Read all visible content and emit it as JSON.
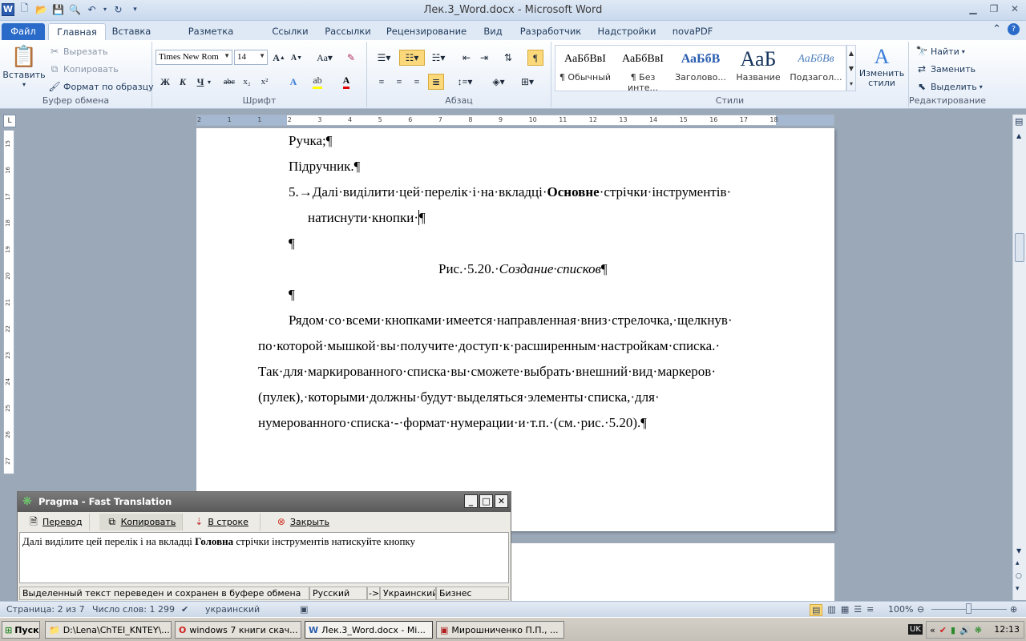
{
  "window": {
    "title": "Лек.3_Word.docx - Microsoft Word"
  },
  "tabs": [
    "Файл",
    "Главная",
    "Вставка",
    "Разметка страницы",
    "Ссылки",
    "Рассылки",
    "Рецензирование",
    "Вид",
    "Разработчик",
    "Надстройки",
    "novaPDF"
  ],
  "clipboard": {
    "paste": "Вставить",
    "cut": "Вырезать",
    "copy": "Копировать",
    "format_painter": "Формат по образцу",
    "label": "Буфер обмена"
  },
  "font": {
    "name": "Times New Rom",
    "size": "14",
    "label": "Шрифт",
    "bold": "Ж",
    "italic": "К",
    "underline": "Ч"
  },
  "paragraph": {
    "label": "Абзац"
  },
  "styles": {
    "label": "Стили",
    "items": [
      {
        "sample": "АаБбВвІ",
        "name": "¶ Обычный"
      },
      {
        "sample": "АаБбВвІ",
        "name": "¶ Без инте..."
      },
      {
        "sample": "АаБбВ",
        "name": "Заголово..."
      },
      {
        "sample": "АаБ",
        "name": "Название"
      },
      {
        "sample": "АаБбВв",
        "name": "Подзагол..."
      }
    ],
    "change": "Изменить стили"
  },
  "editing": {
    "find": "Найти",
    "replace": "Заменить",
    "select": "Выделить",
    "label": "Редактирование"
  },
  "ruler": {
    "ticks": [
      "2",
      "1",
      "1",
      "2",
      "3",
      "4",
      "5",
      "6",
      "7",
      "8",
      "9",
      "10",
      "11",
      "12",
      "13",
      "14",
      "15",
      "16",
      "17",
      "18"
    ]
  },
  "vruler": {
    "ticks": [
      "15",
      "16",
      "17",
      "18",
      "19",
      "20",
      "21",
      "22",
      "23",
      "24",
      "25",
      "26",
      "27"
    ]
  },
  "document": {
    "line1": "Ручка;¶",
    "line2": "Підручник.¶",
    "item5_pre": "5.→Далі·виділити·цей·перелік·і·на·вкладці·",
    "item5_bold": "Основне",
    "item5_post": "·стрічки·інструментів·",
    "item5_cont": "натиснути·кнопки·",
    "pilcrow": "¶",
    "caption_pre": "Рис.·5.20.·",
    "caption_italic": "Создание·списков",
    "para": [
      "Рядом·со·всеми·кнопками·имеется·направленная·вниз·стрелочка,·щелкнув·",
      "по·которой·мышкой·вы·получите·доступ·к·расширенным·настройкам·списка.·",
      "Так·для·маркированного·списка·вы·сможете·выбрать·внешний·вид·маркеров·",
      "(пулек),·которыми·должны·будут·выделяться·элементы·списка,·для·",
      "нумерованного·списка·-·формат·нумерации·и·т.п.·(см.·рис.·5.20).¶"
    ]
  },
  "pragma": {
    "title": "Pragma - Fast Translation",
    "translate": "Перевод",
    "copy": "Копировать",
    "inline": "В строке",
    "close": "Закрыть",
    "text_pre": "Далі виділите цей перелік і на вкладці ",
    "text_bold": "Головна",
    "text_post": " стрічки інструментів натискуйте кнопку",
    "status": "Выделенный текст переведен и сохранен в буфере обмена",
    "lang_from": "Русский",
    "arrow": "->",
    "lang_to": "Украинский",
    "domain": "Бизнес"
  },
  "statusbar": {
    "page": "Страница: 2 из 7",
    "words": "Число слов: 1 299",
    "lang": "украинский",
    "zoom": "100%"
  },
  "taskbar": {
    "start": "Пуск",
    "items": [
      "D:\\Lena\\ChTEI_KNTEY\\...",
      "windows 7 книги скач...",
      "Лек.3_Word.docx - Mi...",
      "Мирошниченко П.П., ..."
    ],
    "lang": "UK",
    "time": "12:13"
  },
  "colors": {
    "ribbon_accent": "#2a6bc9",
    "page": "#ffffff",
    "workspace": "#9ba8b8"
  }
}
